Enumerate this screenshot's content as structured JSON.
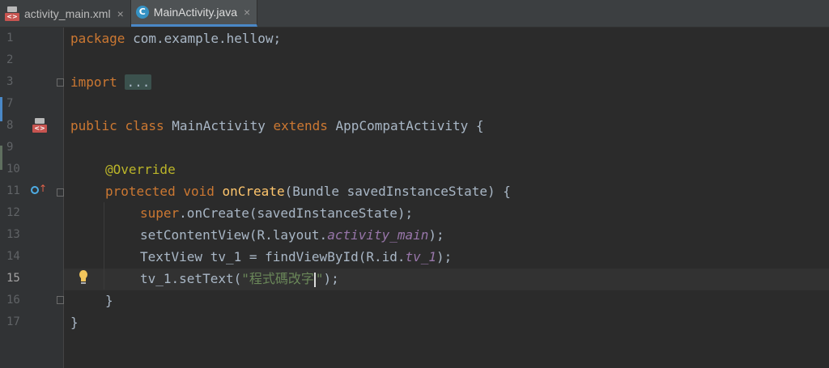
{
  "tabs": [
    {
      "label": "activity_main.xml",
      "icon": "xml-layout-file-icon",
      "active": false
    },
    {
      "label": "MainActivity.java",
      "icon": "java-class-icon",
      "active": true
    }
  ],
  "tab_icon_text": {
    "xml": "<>",
    "java": "C"
  },
  "close_glyph": "×",
  "line_numbers": [
    "1",
    "2",
    "3",
    "7",
    "8",
    "9",
    "10",
    "11",
    "12",
    "13",
    "14",
    "15",
    "16",
    "17"
  ],
  "current_line": "15",
  "code": {
    "l1": {
      "kw": "package",
      "rest": " com.example.hellow;"
    },
    "l3": {
      "kw": "import",
      "folded": "..."
    },
    "l8": {
      "kw1": "public",
      "kw2": "class",
      "name": " MainActivity ",
      "kw3": "extends",
      "rest": " AppCompatActivity {"
    },
    "l10": {
      "annotation": "@Override"
    },
    "l11": {
      "kw1": "protected",
      "kw2": "void",
      "fn": "onCreate",
      "rest": "(Bundle savedInstanceState) {"
    },
    "l12": {
      "kw": "super",
      "rest": ".onCreate(savedInstanceState);"
    },
    "l13": {
      "a": "setContentView(R.layout.",
      "italic": "activity_main",
      "b": ");"
    },
    "l14": {
      "a": "TextView tv_1 = findViewById(R.id.",
      "italic": "tv_1",
      "b": ");"
    },
    "l15": {
      "a": "tv_1.setText(",
      "str": "\"程式碼改字",
      "str_end": "\"",
      "b": ");"
    },
    "l16": {
      "text": "}"
    },
    "l17": {
      "text": "}"
    }
  },
  "colors": {
    "background": "#2b2b2b",
    "keyword": "#cc7832",
    "annotation": "#bbb529",
    "method": "#ffc66d",
    "field": "#9876aa",
    "string": "#6a8759",
    "text": "#a9b7c6",
    "tab_accent": "#4a88c7"
  }
}
